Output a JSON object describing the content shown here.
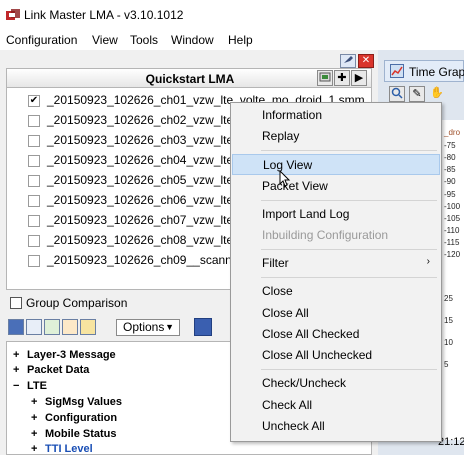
{
  "app": {
    "title": "Link Master LMA  -  v3.10.1012"
  },
  "menubar": [
    "Configuration",
    "View",
    "Tools",
    "Window",
    "Help"
  ],
  "quickstart": {
    "title": "Quickstart LMA",
    "files": [
      {
        "name": "_20150923_102626_ch01_vzw_lte_volte_mo_droid_1.smm",
        "checked": true
      },
      {
        "name": "_20150923_102626_ch02_vzw_lte_vo",
        "checked": false
      },
      {
        "name": "_20150923_102626_ch03_vzw_lte_vo",
        "checked": false
      },
      {
        "name": "_20150923_102626_ch04_vzw_lte_vo",
        "checked": false
      },
      {
        "name": "_20150923_102626_ch05_vzw_lte_vo",
        "checked": false
      },
      {
        "name": "_20150923_102626_ch06_vzw_lte_vo",
        "checked": false
      },
      {
        "name": "_20150923_102626_ch07_vzw_lte_vo",
        "checked": false
      },
      {
        "name": "_20150923_102626_ch08_vzw_lte_vo",
        "checked": false
      },
      {
        "name": "_20150923_102626_ch09__scanner_",
        "checked": false
      }
    ],
    "group_comparison": "Group Comparison"
  },
  "bottom_toolbar": {
    "options_label": "Options"
  },
  "tree": [
    {
      "label": "Layer-3 Message",
      "expander": "+",
      "level": 0
    },
    {
      "label": "Packet Data",
      "expander": "+",
      "level": 0
    },
    {
      "label": "LTE",
      "expander": "−",
      "level": 0
    },
    {
      "label": "SigMsg Values",
      "expander": "+",
      "level": 1
    },
    {
      "label": "Configuration",
      "expander": "+",
      "level": 1
    },
    {
      "label": "Mobile Status",
      "expander": "+",
      "level": 1
    },
    {
      "label": "TTI Level",
      "expander": "+",
      "level": 1
    }
  ],
  "time_graph": {
    "title": "Time Grap",
    "series_label": "_dro",
    "ticks": [
      "-75",
      "-80",
      "-85",
      "-90",
      "-95",
      "-100",
      "-105",
      "-110",
      "-115",
      "-120",
      "25",
      "15",
      "10",
      "5"
    ],
    "time_label": "21:12"
  },
  "context_menu": {
    "items": [
      {
        "label": "Information"
      },
      {
        "label": "Replay"
      },
      {
        "label": "Log View",
        "highlighted": true
      },
      {
        "label": "Packet View"
      },
      {
        "label": "Import Land Log"
      },
      {
        "label": "Inbuilding Configuration",
        "disabled": true
      },
      {
        "label": "Filter",
        "submenu": true
      },
      {
        "label": "Close"
      },
      {
        "label": "Close All"
      },
      {
        "label": "Close All Checked"
      },
      {
        "label": "Close All Unchecked"
      },
      {
        "label": "Check/Uncheck"
      },
      {
        "label": "Check All"
      },
      {
        "label": "Uncheck All"
      }
    ]
  },
  "icons": {
    "app": "app-logo-icon",
    "pin": "pin-icon",
    "close": "close-icon",
    "add": "add-icon",
    "play": "play-icon",
    "import": "import-icon",
    "chevron": "chevron-down-icon",
    "arrow": "submenu-arrow-icon"
  },
  "colors": {
    "menu_highlight": "#cfe3f7",
    "tree_link": "#1a4fb5",
    "close_red": "#d9342b"
  }
}
